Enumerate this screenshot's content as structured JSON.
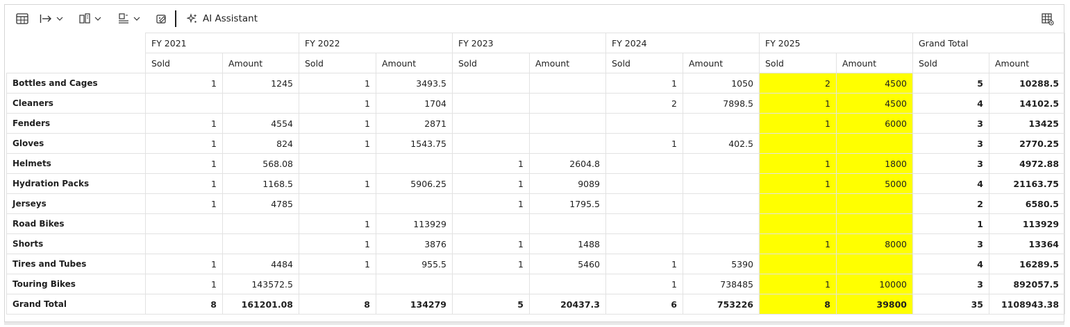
{
  "toolbar": {
    "ai_assistant_label": "AI Assistant"
  },
  "years": [
    "FY 2021",
    "FY 2022",
    "FY 2023",
    "FY 2024",
    "FY 2025",
    "Grand Total"
  ],
  "subheaders": {
    "sold": "Sold",
    "amount": "Amount"
  },
  "highlight_color": "#ffff00",
  "rows": [
    {
      "label": "Bottles and Cages",
      "c": [
        "1",
        "1245",
        "1",
        "3493.5",
        "",
        "",
        "1",
        "1050",
        "2",
        "4500",
        "5",
        "10288.5"
      ]
    },
    {
      "label": "Cleaners",
      "c": [
        "",
        "",
        "1",
        "1704",
        "",
        "",
        "2",
        "7898.5",
        "1",
        "4500",
        "4",
        "14102.5"
      ]
    },
    {
      "label": "Fenders",
      "c": [
        "1",
        "4554",
        "1",
        "2871",
        "",
        "",
        "",
        "",
        "1",
        "6000",
        "3",
        "13425"
      ]
    },
    {
      "label": "Gloves",
      "c": [
        "1",
        "824",
        "1",
        "1543.75",
        "",
        "",
        "1",
        "402.5",
        "",
        "",
        "3",
        "2770.25"
      ]
    },
    {
      "label": "Helmets",
      "c": [
        "1",
        "568.08",
        "",
        "",
        "1",
        "2604.8",
        "",
        "",
        "1",
        "1800",
        "3",
        "4972.88"
      ]
    },
    {
      "label": "Hydration Packs",
      "c": [
        "1",
        "1168.5",
        "1",
        "5906.25",
        "1",
        "9089",
        "",
        "",
        "1",
        "5000",
        "4",
        "21163.75"
      ]
    },
    {
      "label": "Jerseys",
      "c": [
        "1",
        "4785",
        "",
        "",
        "1",
        "1795.5",
        "",
        "",
        "",
        "",
        "2",
        "6580.5"
      ]
    },
    {
      "label": "Road Bikes",
      "c": [
        "",
        "",
        "1",
        "113929",
        "",
        "",
        "",
        "",
        "",
        "",
        "1",
        "113929"
      ]
    },
    {
      "label": "Shorts",
      "c": [
        "",
        "",
        "1",
        "3876",
        "1",
        "1488",
        "",
        "",
        "1",
        "8000",
        "3",
        "13364"
      ]
    },
    {
      "label": "Tires and Tubes",
      "c": [
        "1",
        "4484",
        "1",
        "955.5",
        "1",
        "5460",
        "1",
        "5390",
        "",
        "",
        "4",
        "16289.5"
      ]
    },
    {
      "label": "Touring Bikes",
      "c": [
        "1",
        "143572.5",
        "",
        "",
        "",
        "",
        "1",
        "738485",
        "1",
        "10000",
        "3",
        "892057.5"
      ]
    },
    {
      "label": "Grand Total",
      "c": [
        "8",
        "161201.08",
        "8",
        "134279",
        "5",
        "20437.3",
        "6",
        "753226",
        "8",
        "39800",
        "35",
        "1108943.38"
      ]
    }
  ]
}
